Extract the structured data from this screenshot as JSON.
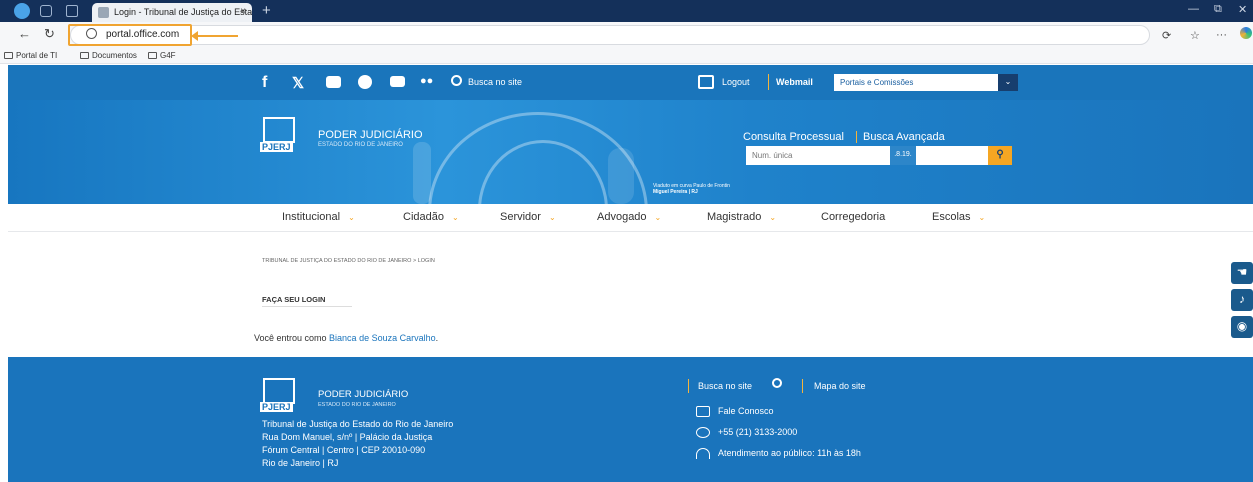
{
  "browser": {
    "tab_title": "Login - Tribunal de Justiça do Esta",
    "tab_close": "×",
    "new_tab": "+",
    "url": "portal.office.com",
    "window_controls": [
      "—",
      "⧉",
      "✕"
    ],
    "favorites": [
      "Portal de TI",
      "Documentos",
      "G4F"
    ],
    "toolbar_right": [
      "⟳",
      "☆",
      "···"
    ],
    "highlight_color": "#f0a431"
  },
  "header": {
    "search_label": "Busca no site",
    "logout_label": "Logout",
    "webmail_label": "Webmail",
    "portais_select": "Portais e Comissões",
    "social_icons": [
      "facebook-icon",
      "x-icon",
      "instagram-icon",
      "spotify-icon",
      "youtube-icon",
      "flickr-icon"
    ]
  },
  "banner": {
    "logo_text": "PJERJ",
    "org_name": "PODER JUDICIÁRIO",
    "org_sub": "ESTADO DO RIO DE JANEIRO",
    "consulta_label": "Consulta Processual",
    "busca_avancada_label": "Busca Avançada",
    "num_placeholder": "Num. única",
    "num_suffix": ".8.19.",
    "photo_credit": "Viaduto em curva Paulo de Frontin",
    "photo_author": "Miguel Pereira | RJ"
  },
  "menu": {
    "items": [
      {
        "label": "Institucional",
        "has_dropdown": true
      },
      {
        "label": "Cidadão",
        "has_dropdown": true
      },
      {
        "label": "Servidor",
        "has_dropdown": true
      },
      {
        "label": "Advogado",
        "has_dropdown": true
      },
      {
        "label": "Magistrado",
        "has_dropdown": true
      },
      {
        "label": "Corregedoria",
        "has_dropdown": false
      },
      {
        "label": "Escolas",
        "has_dropdown": true
      }
    ]
  },
  "main": {
    "breadcrumb": "TRIBUNAL DE JUSTIÇA DO ESTADO DO RIO DE JANEIRO  >  LOGIN",
    "login_title": "FAÇA SEU LOGIN",
    "logged_prefix": "Você entrou como ",
    "user_name": "Bianca de Souza Carvalho",
    "logged_suffix": "."
  },
  "footer": {
    "org_name": "PODER JUDICIÁRIO",
    "org_sub": "ESTADO DO RIO DE JANEIRO",
    "address_lines": [
      "Tribunal de Justiça do Estado do Rio de Janeiro",
      "Rua Dom Manuel, s/nº | Palácio da Justiça",
      "Fórum Central | Centro | CEP 20010-090",
      "Rio de Janeiro | RJ"
    ],
    "busca_label": "Busca no site",
    "mapa_label": "Mapa do site",
    "contact": [
      "Fale Conosco",
      "+55 (21) 3133-2000",
      "Atendimento ao público: 11h às 18h"
    ]
  },
  "colors": {
    "brand_blue": "#1a74bc",
    "accent_orange": "#f5a623",
    "navy": "#173e6e"
  }
}
